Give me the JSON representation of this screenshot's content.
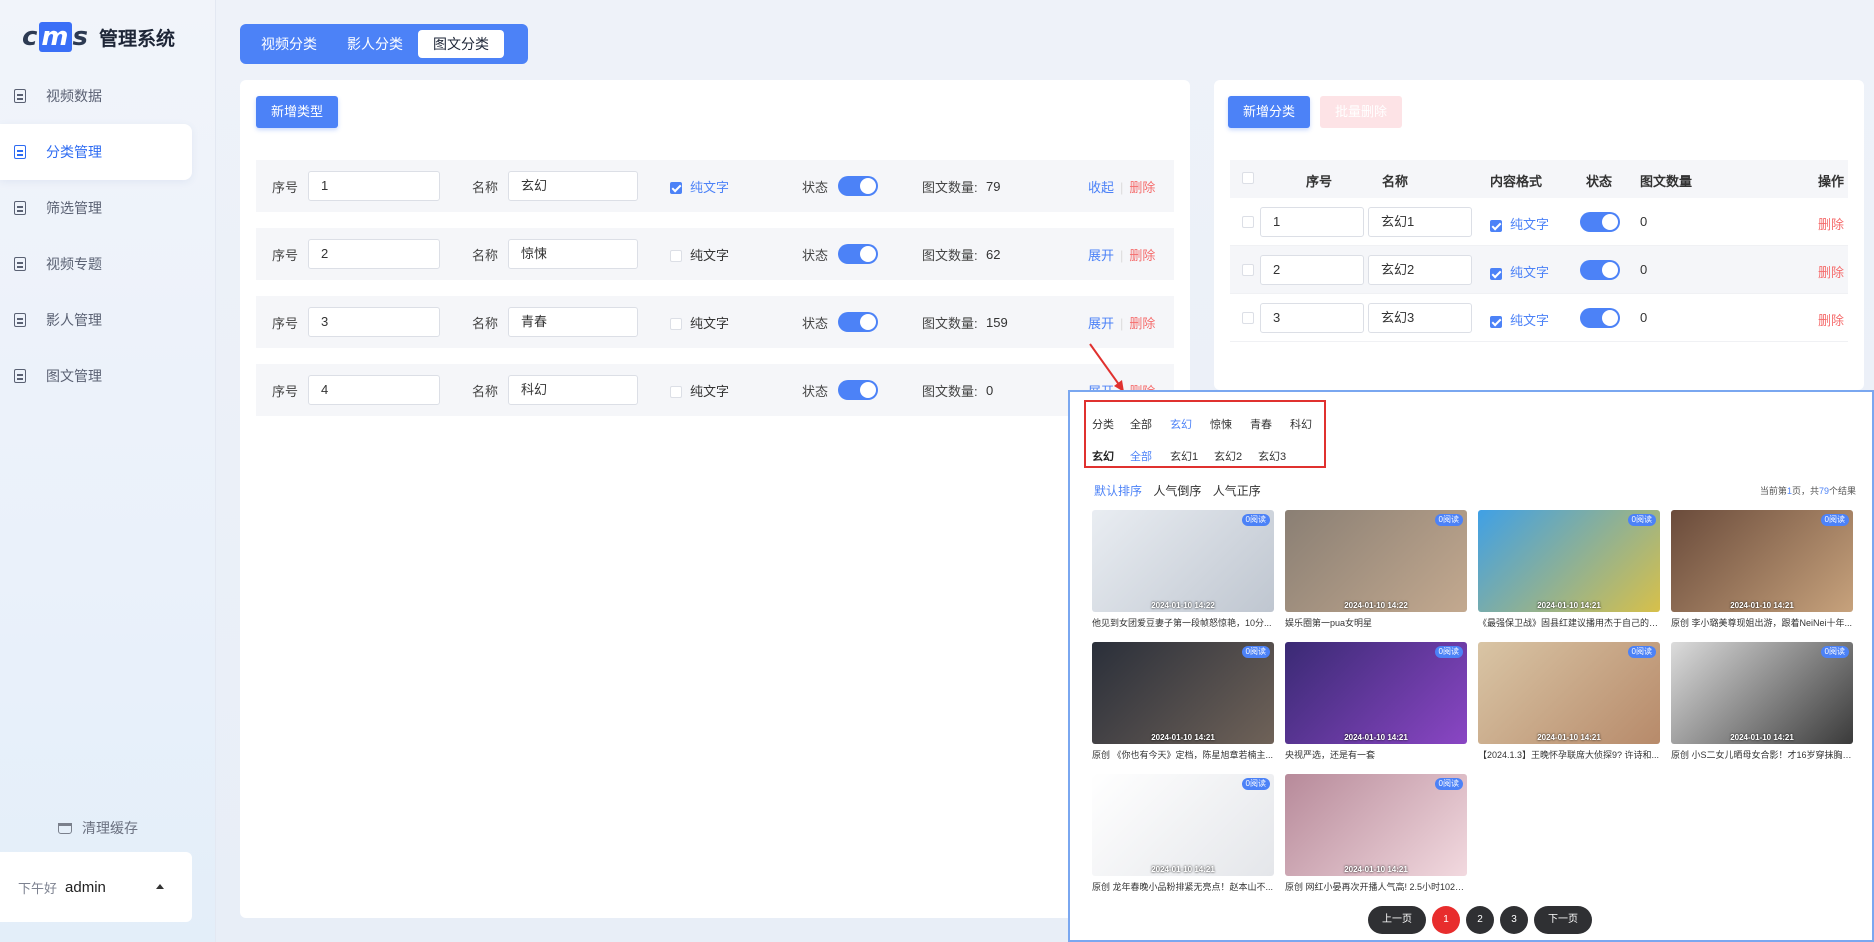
{
  "brand": {
    "logo": "cms",
    "title": "管理系统"
  },
  "sidebar": {
    "items": [
      {
        "label": "视频数据",
        "active": false
      },
      {
        "label": "分类管理",
        "active": true
      },
      {
        "label": "筛选管理",
        "active": false
      },
      {
        "label": "视频专题",
        "active": false
      },
      {
        "label": "影人管理",
        "active": false
      },
      {
        "label": "图文管理",
        "active": false
      }
    ],
    "clear_cache": "清理缓存",
    "greeting": "下午好",
    "username": "admin"
  },
  "tabs": [
    {
      "label": "视频分类",
      "active": false
    },
    {
      "label": "影人分类",
      "active": false
    },
    {
      "label": "图文分类",
      "active": true
    }
  ],
  "left": {
    "add_type": "新增类型",
    "labels": {
      "order": "序号",
      "name": "名称",
      "text_only": "纯文字",
      "status": "状态",
      "count": "图文数量:"
    },
    "rows": [
      {
        "order": "1",
        "name": "玄幻",
        "text_only": true,
        "count": "79",
        "toggle": "收起",
        "delete": "删除"
      },
      {
        "order": "2",
        "name": "惊悚",
        "text_only": false,
        "count": "62",
        "toggle": "展开",
        "delete": "删除"
      },
      {
        "order": "3",
        "name": "青春",
        "text_only": false,
        "count": "159",
        "toggle": "展开",
        "delete": "删除"
      },
      {
        "order": "4",
        "name": "科幻",
        "text_only": false,
        "count": "0",
        "toggle": "展开",
        "delete": "删除"
      }
    ]
  },
  "right": {
    "add_category": "新增分类",
    "batch_delete": "批量删除",
    "headers": {
      "order": "序号",
      "name": "名称",
      "format": "内容格式",
      "status": "状态",
      "count": "图文数量",
      "action": "操作"
    },
    "rows": [
      {
        "order": "1",
        "name": "玄幻1",
        "format": "纯文字",
        "count": "0",
        "action": "删除"
      },
      {
        "order": "2",
        "name": "玄幻2",
        "format": "纯文字",
        "count": "0",
        "action": "删除"
      },
      {
        "order": "3",
        "name": "玄幻3",
        "format": "纯文字",
        "count": "0",
        "action": "删除"
      }
    ]
  },
  "preview": {
    "filter_row1": {
      "label": "分类",
      "items": [
        "全部",
        "玄幻",
        "惊悚",
        "青春",
        "科幻"
      ],
      "active": "玄幻"
    },
    "filter_row2": {
      "label": "玄幻",
      "items": [
        "全部",
        "玄幻1",
        "玄幻2",
        "玄幻3"
      ],
      "active": "全部"
    },
    "sort": [
      "默认排序",
      "人气倒序",
      "人气正序"
    ],
    "page_info": {
      "prefix": "当前第",
      "page": "1",
      "mid": "页，共",
      "total": "79",
      "suffix": "个结果"
    },
    "badge": "0阅读",
    "items": [
      {
        "time": "2024-01-10 14:22",
        "caption": "他见到女团爱豆妻子第一段帧怒惊艳，10分...",
        "colors": [
          "#e9edf2",
          "#bfc6d0"
        ]
      },
      {
        "time": "2024-01-10 14:22",
        "caption": "娱乐圈第一pua女明星",
        "colors": [
          "#8a7f74",
          "#c3a98f"
        ]
      },
      {
        "time": "2024-01-10 14:21",
        "caption": "《最强保卫战》固县红建议播用杰于自己的选择",
        "colors": [
          "#3fa0e6",
          "#d7c04a"
        ]
      },
      {
        "time": "2024-01-10 14:21",
        "caption": "原创 李小璐美尊现姐出游，跟着NeiNei十年...",
        "colors": [
          "#6a4b3b",
          "#c7a27c"
        ]
      },
      {
        "time": "2024-01-10 14:21",
        "caption": "原创 《你也有今天》定档，陈星旭章若楠主...",
        "colors": [
          "#2a2f3a",
          "#6f6258"
        ]
      },
      {
        "time": "2024-01-10 14:21",
        "caption": "央视严选，还是有一套",
        "colors": [
          "#3a2a74",
          "#8a46c4"
        ]
      },
      {
        "time": "2024-01-10 14:21",
        "caption": "【2024.1.3】王晚怀孕联席大侦探9?  许诗和...",
        "colors": [
          "#d9c5a5",
          "#b78a6a"
        ]
      },
      {
        "time": "2024-01-10 14:21",
        "caption": "原创 小S二女儿晒母女合影！才16岁穿抹胸超...",
        "colors": [
          "#dcdcdc",
          "#3a3a3a"
        ]
      },
      {
        "time": "2024-01-10 14:21",
        "caption": "原创 龙年春晚小品粉排紧无亮点！赵本山不...",
        "colors": [
          "#ffffff",
          "#e4e6ea"
        ]
      },
      {
        "time": "2024-01-10 14:21",
        "caption": "原创 网红小晏再次开播人气高! 2.5小时1023...",
        "colors": [
          "#b78a9a",
          "#f2d9df"
        ]
      }
    ],
    "pager": {
      "prev": "上一页",
      "pages": [
        "1",
        "2",
        "3"
      ],
      "current": "1",
      "next": "下一页"
    }
  },
  "colors": {
    "primary": "#4c82f7",
    "danger": "#f56c6c",
    "highlight_border": "#e0312f",
    "pager_active": "#e82d2d"
  }
}
